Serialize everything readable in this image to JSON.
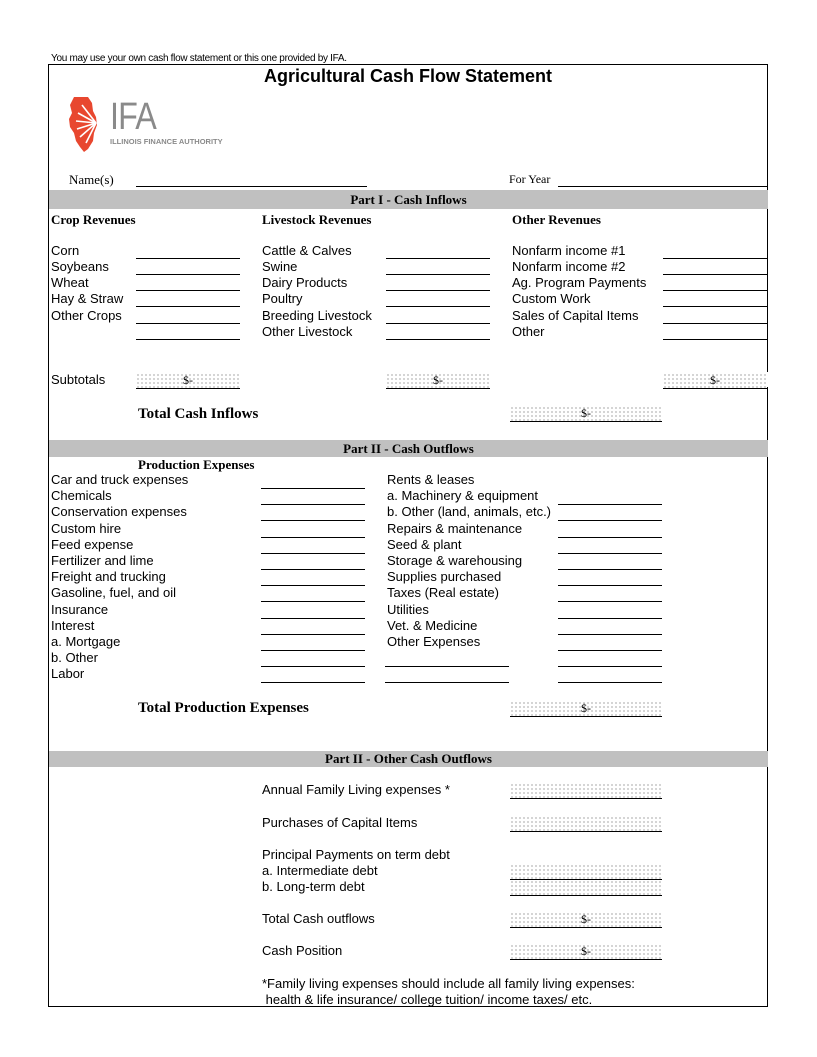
{
  "note_top": "You may use your own cash flow statement or this one provided by IFA.",
  "title": "Agricultural Cash Flow Statement",
  "logo": {
    "icon": "illinois-state-sunburst-icon",
    "letters": "IFA",
    "subtitle": "ILLINOIS FINANCE AUTHORITY",
    "color": "#e8472f"
  },
  "header": {
    "name_label": "Name(s)",
    "name_value": "",
    "year_label": "For Year",
    "year_value": ""
  },
  "part1": {
    "title": "Part I - Cash Inflows",
    "crop": {
      "heading": "Crop Revenues",
      "items": [
        "Corn",
        "Soybeans",
        "Wheat",
        "Hay & Straw",
        "Other Crops",
        ""
      ],
      "subtotal": "$-"
    },
    "livestock": {
      "heading": "Livestock Revenues",
      "items": [
        "Cattle & Calves",
        "Swine",
        "Dairy Products",
        "Poultry",
        "Breeding Livestock",
        "Other Livestock"
      ],
      "subtotal": "$-"
    },
    "other": {
      "heading": "Other Revenues",
      "items": [
        "Nonfarm income #1",
        "Nonfarm income #2",
        "Ag. Program Payments",
        "Custom Work",
        "Sales of Capital Items",
        "Other"
      ],
      "subtotal": "$-"
    },
    "subtotals_label": "Subtotals",
    "total_label": "Total Cash Inflows",
    "total_value": "$-"
  },
  "part2": {
    "title": "Part II - Cash Outflows",
    "heading": "Production Expenses",
    "left_items": [
      "Car and truck expenses",
      "Chemicals",
      "Conservation expenses",
      "Custom hire",
      "Feed expense",
      "Fertilizer and lime",
      "Freight and trucking",
      "Gasoline, fuel, and oil",
      "Insurance",
      "Interest",
      "a. Mortgage",
      "b. Other",
      "Labor"
    ],
    "right_items": [
      "Rents & leases",
      "a. Machinery & equipment",
      "b. Other (land, animals, etc.)",
      "Repairs & maintenance",
      "Seed & plant",
      "Storage & warehousing",
      "Supplies purchased",
      "Taxes (Real estate)",
      "Utilities",
      "Vet. & Medicine",
      "Other Expenses"
    ],
    "total_label": "Total Production Expenses",
    "total_value": "$-"
  },
  "part3": {
    "title": "Part II - Other Cash Outflows",
    "family_label": "Annual Family Living expenses *",
    "family_value": "",
    "capital_label": "Purchases of Capital Items",
    "capital_value": "",
    "principal_label": "Principal Payments on term debt",
    "intermediate_label": "a. Intermediate debt",
    "intermediate_value": "",
    "longterm_label": "b. Long-term debt",
    "longterm_value": "",
    "total_outflows_label": "Total Cash outflows",
    "total_outflows_value": "$-",
    "cash_position_label": "Cash Position",
    "cash_position_value": "$-",
    "footnote_1": "*Family living expenses should include all family living expenses:",
    "footnote_2": " health & life insurance/ college tuition/ income taxes/ etc."
  }
}
